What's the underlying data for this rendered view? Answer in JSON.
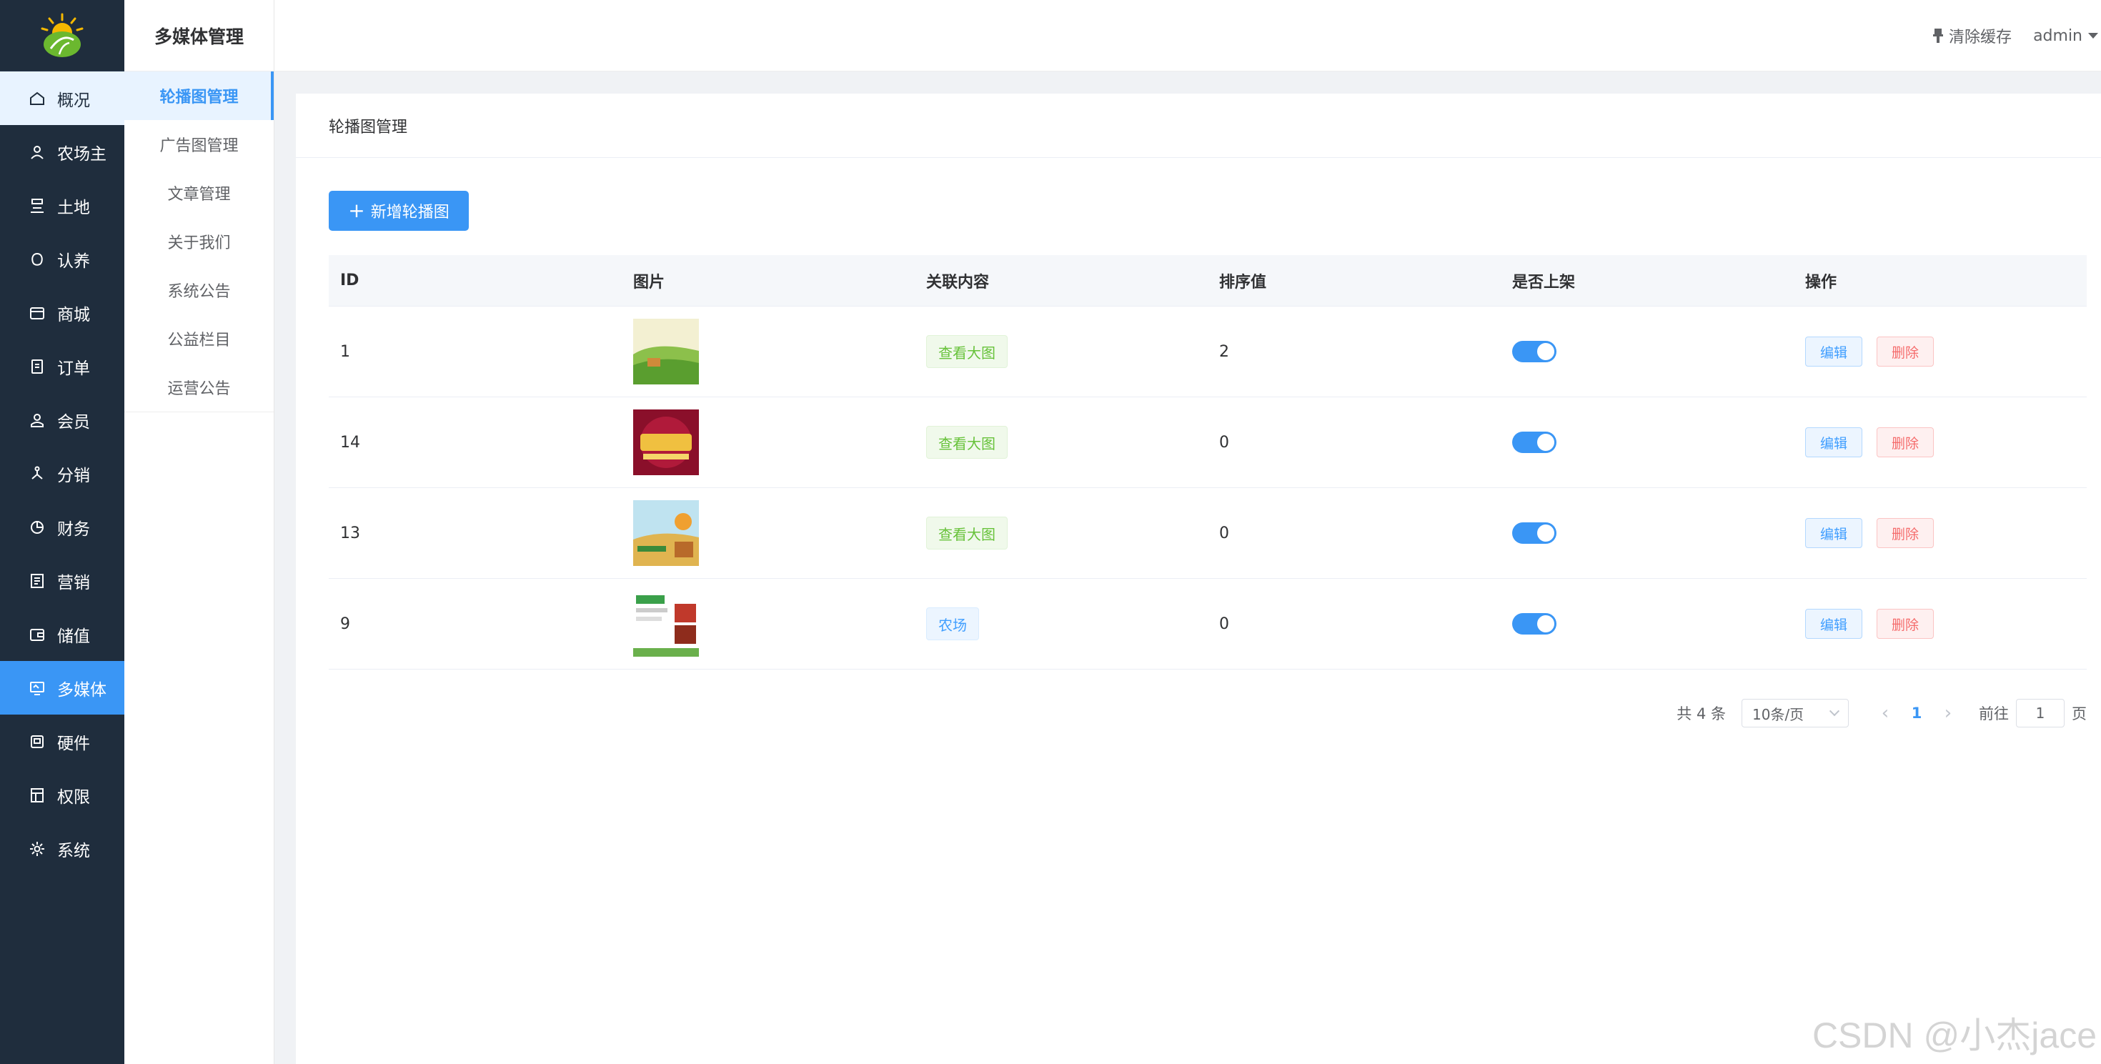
{
  "nav_primary": {
    "items": [
      {
        "label": "概况",
        "icon": "home-icon"
      },
      {
        "label": "农场主",
        "icon": "farmer-icon"
      },
      {
        "label": "土地",
        "icon": "land-icon"
      },
      {
        "label": "认养",
        "icon": "adopt-icon"
      },
      {
        "label": "商城",
        "icon": "store-icon"
      },
      {
        "label": "订单",
        "icon": "order-icon"
      },
      {
        "label": "会员",
        "icon": "member-icon"
      },
      {
        "label": "分销",
        "icon": "distribution-icon"
      },
      {
        "label": "财务",
        "icon": "finance-icon"
      },
      {
        "label": "营销",
        "icon": "marketing-icon"
      },
      {
        "label": "储值",
        "icon": "wallet-icon"
      },
      {
        "label": "多媒体",
        "icon": "media-icon"
      },
      {
        "label": "硬件",
        "icon": "hardware-icon"
      },
      {
        "label": "权限",
        "icon": "permission-icon"
      },
      {
        "label": "系统",
        "icon": "settings-icon"
      }
    ],
    "active": "多媒体"
  },
  "nav_secondary": {
    "title": "多媒体管理",
    "items": [
      "轮播图管理",
      "广告图管理",
      "文章管理",
      "关于我们",
      "系统公告",
      "公益栏目",
      "运营公告"
    ],
    "active": "轮播图管理"
  },
  "header": {
    "clear_cache": "清除缓存",
    "user": "admin"
  },
  "page": {
    "title": "轮播图管理",
    "add_button": "新增轮播图"
  },
  "table": {
    "columns": [
      "ID",
      "图片",
      "关联内容",
      "排序值",
      "是否上架",
      "操作"
    ],
    "rows": [
      {
        "id": "1",
        "image": "生态农场",
        "link": "查看大图",
        "link_type": "green",
        "sort": "2",
        "on_shelf": true
      },
      {
        "id": "14",
        "image": "双12来了",
        "link": "查看大图",
        "link_type": "green",
        "sort": "0",
        "on_shelf": true
      },
      {
        "id": "13",
        "image": "农场放心",
        "link": "查看大图",
        "link_type": "green",
        "sort": "0",
        "on_shelf": true
      },
      {
        "id": "9",
        "image": "果蔬时节",
        "link": "农场",
        "link_type": "blue",
        "sort": "0",
        "on_shelf": true
      }
    ],
    "edit_label": "编辑",
    "delete_label": "删除"
  },
  "pagination": {
    "total": "共 4 条",
    "page_size": "10条/页",
    "current": "1",
    "goto_prefix": "前往",
    "goto_value": "1",
    "goto_suffix": "页"
  },
  "watermark": "CSDN @小杰jace",
  "colors": {
    "sidebar_bg": "#1f2d3d",
    "accent": "#3a96f5"
  }
}
